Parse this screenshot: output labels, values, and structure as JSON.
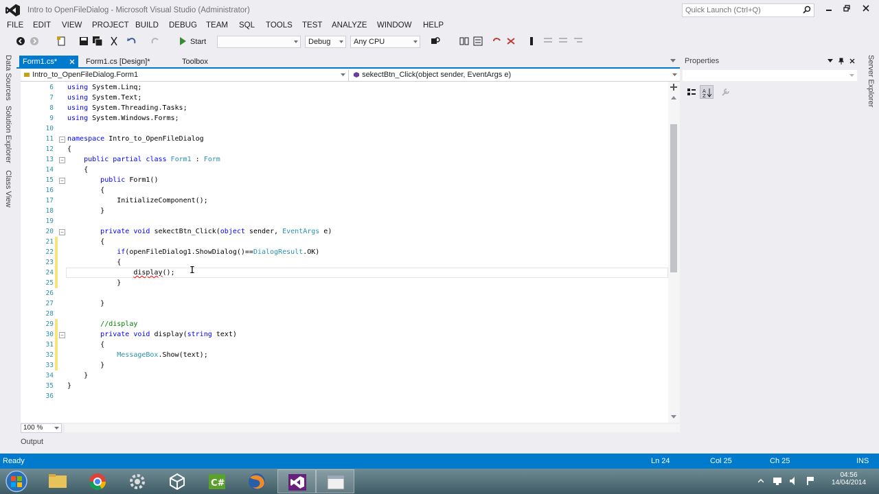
{
  "window": {
    "title": "Intro to OpenFileDialog - Microsoft Visual Studio (Administrator)",
    "quick_launch_placeholder": "Quick Launch (Ctrl+Q)"
  },
  "menu": [
    "FILE",
    "EDIT",
    "VIEW",
    "PROJECT",
    "BUILD",
    "DEBUG",
    "TEAM",
    "SQL",
    "TOOLS",
    "TEST",
    "ANALYZE",
    "WINDOW",
    "HELP"
  ],
  "toolbar": {
    "start_label": "Start",
    "config": "Debug",
    "platform": "Any CPU"
  },
  "left_tabs": [
    "Data Sources",
    "Solution Explorer",
    "Class View"
  ],
  "right_tabs": [
    "Server Explorer"
  ],
  "doc_tabs": [
    "Form1.cs*",
    "Form1.cs [Design]*",
    "Toolbox"
  ],
  "nav": {
    "class_combo": "Intro_to_OpenFileDialog.Form1",
    "member_combo": "sekectBtn_Click(object sender, EventArgs e)"
  },
  "code_lines": [
    {
      "n": "6",
      "t": "using System.Linq;"
    },
    {
      "n": "7",
      "t": "using System.Text;"
    },
    {
      "n": "8",
      "t": "using System.Threading.Tasks;"
    },
    {
      "n": "9",
      "t": "using System.Windows.Forms;"
    },
    {
      "n": "10",
      "t": ""
    },
    {
      "n": "11",
      "t": "namespace Intro_to_OpenFileDialog"
    },
    {
      "n": "12",
      "t": "{"
    },
    {
      "n": "13",
      "t": "    public partial class Form1 : Form"
    },
    {
      "n": "14",
      "t": "    {"
    },
    {
      "n": "15",
      "t": "        public Form1()"
    },
    {
      "n": "16",
      "t": "        {"
    },
    {
      "n": "17",
      "t": "            InitializeComponent();"
    },
    {
      "n": "18",
      "t": "        }"
    },
    {
      "n": "19",
      "t": ""
    },
    {
      "n": "20",
      "t": "        private void sekectBtn_Click(object sender, EventArgs e)"
    },
    {
      "n": "21",
      "t": "        {"
    },
    {
      "n": "22",
      "t": "            if(openFileDialog1.ShowDialog()==DialogResult.OK)"
    },
    {
      "n": "23",
      "t": "            {"
    },
    {
      "n": "24",
      "t": "                display();"
    },
    {
      "n": "25",
      "t": "            }"
    },
    {
      "n": "26",
      "t": ""
    },
    {
      "n": "27",
      "t": "        }"
    },
    {
      "n": "28",
      "t": ""
    },
    {
      "n": "29",
      "t": "        //display"
    },
    {
      "n": "30",
      "t": "        private void display(string text)"
    },
    {
      "n": "31",
      "t": "        {"
    },
    {
      "n": "32",
      "t": "            MessageBox.Show(text);"
    },
    {
      "n": "33",
      "t": "        }"
    },
    {
      "n": "34",
      "t": "    }"
    },
    {
      "n": "35",
      "t": "}"
    },
    {
      "n": "36",
      "t": ""
    }
  ],
  "editor": {
    "zoom": "100 %"
  },
  "output_tab": "Output",
  "properties": {
    "title": "Properties"
  },
  "status": {
    "state": "Ready",
    "ln": "Ln 24",
    "col": "Col 25",
    "ch": "Ch 25",
    "mode": "INS"
  },
  "taskbar": {
    "time": "04:56",
    "date": "14/04/2014"
  },
  "colors": {
    "accent": "#007acc",
    "keyword": "#0000ff",
    "type": "#2b91af",
    "comment": "#008000"
  }
}
